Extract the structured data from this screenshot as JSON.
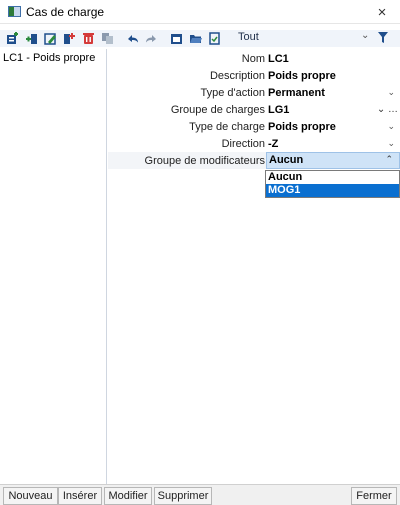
{
  "window": {
    "title": "Cas de charge",
    "close_symbol": "×"
  },
  "toolbar": {
    "filter_label": "Tout",
    "dropdown_arrow": "⌄"
  },
  "load_cases": [
    {
      "label": "LC1 - Poids propre"
    }
  ],
  "properties": [
    {
      "label": "Nom",
      "value": "LC1",
      "arrow": "",
      "extra": ""
    },
    {
      "label": "Description",
      "value": "Poids propre",
      "arrow": "",
      "extra": ""
    },
    {
      "label": "Type d'action",
      "value": "Permanent",
      "arrow": "⌄",
      "extra": ""
    },
    {
      "label": "Groupe de charges",
      "value": "LG1",
      "arrow": "",
      "extra": "⌄ …"
    },
    {
      "label": "Type de charge",
      "value": "Poids propre",
      "arrow": "⌄",
      "extra": ""
    },
    {
      "label": "Direction",
      "value": "-Z",
      "arrow": "⌄",
      "extra": ""
    },
    {
      "label": "Groupe de modificateurs",
      "value": "Aucun",
      "arrow": "⌃",
      "extra": ""
    }
  ],
  "dropdown": {
    "options": [
      "Aucun",
      "MOG1"
    ],
    "highlighted": "MOG1"
  },
  "buttons": {
    "new": "Nouveau",
    "insert": "Insérer",
    "modify": "Modifier",
    "delete": "Supprimer",
    "close": "Fermer"
  },
  "colors": {
    "toolbar_bg": "#f0f4fa",
    "combo_active": "#cfe3f7",
    "dropdown_highlight": "#0a6fd0",
    "icon_green": "#2c8a3e",
    "icon_blue": "#1f4e8c",
    "icon_red": "#d43a3a"
  }
}
